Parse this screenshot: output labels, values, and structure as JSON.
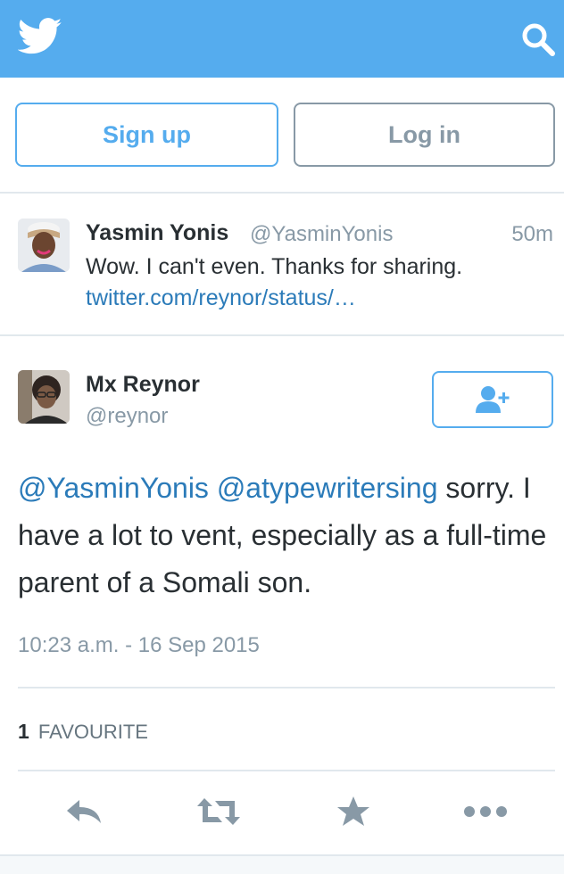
{
  "colors": {
    "brand": "#55acee",
    "link": "#2b7bb9",
    "muted": "#8899a6",
    "text": "#292f33",
    "divider": "#e1e8ed"
  },
  "header": {
    "logo_icon": "twitter-bird-icon",
    "search_icon": "search-icon"
  },
  "auth": {
    "signup_label": "Sign up",
    "login_label": "Log in"
  },
  "reply_tweet": {
    "name": "Yasmin Yonis",
    "handle": "@YasminYonis",
    "time": "50m",
    "text": "Wow. I can't even. Thanks for sharing.",
    "link": "twitter.com/reynor/status/…"
  },
  "main_tweet": {
    "name": "Mx Reynor",
    "handle": "@reynor",
    "follow_icon": "follow-user-icon",
    "mentions": [
      "@YasminYonis",
      "@atypewritersing"
    ],
    "text_after_mentions": "sorry. I have a lot to vent, especially as a full-time parent of a Somali son.",
    "timestamp": "10:23 a.m. - 16 Sep 2015",
    "favourite_count": "1",
    "favourite_label": "FAVOURITE"
  },
  "actions": [
    {
      "name": "reply",
      "icon": "reply-icon"
    },
    {
      "name": "retweet",
      "icon": "retweet-icon"
    },
    {
      "name": "favourite",
      "icon": "star-icon"
    },
    {
      "name": "more",
      "icon": "more-icon"
    }
  ]
}
